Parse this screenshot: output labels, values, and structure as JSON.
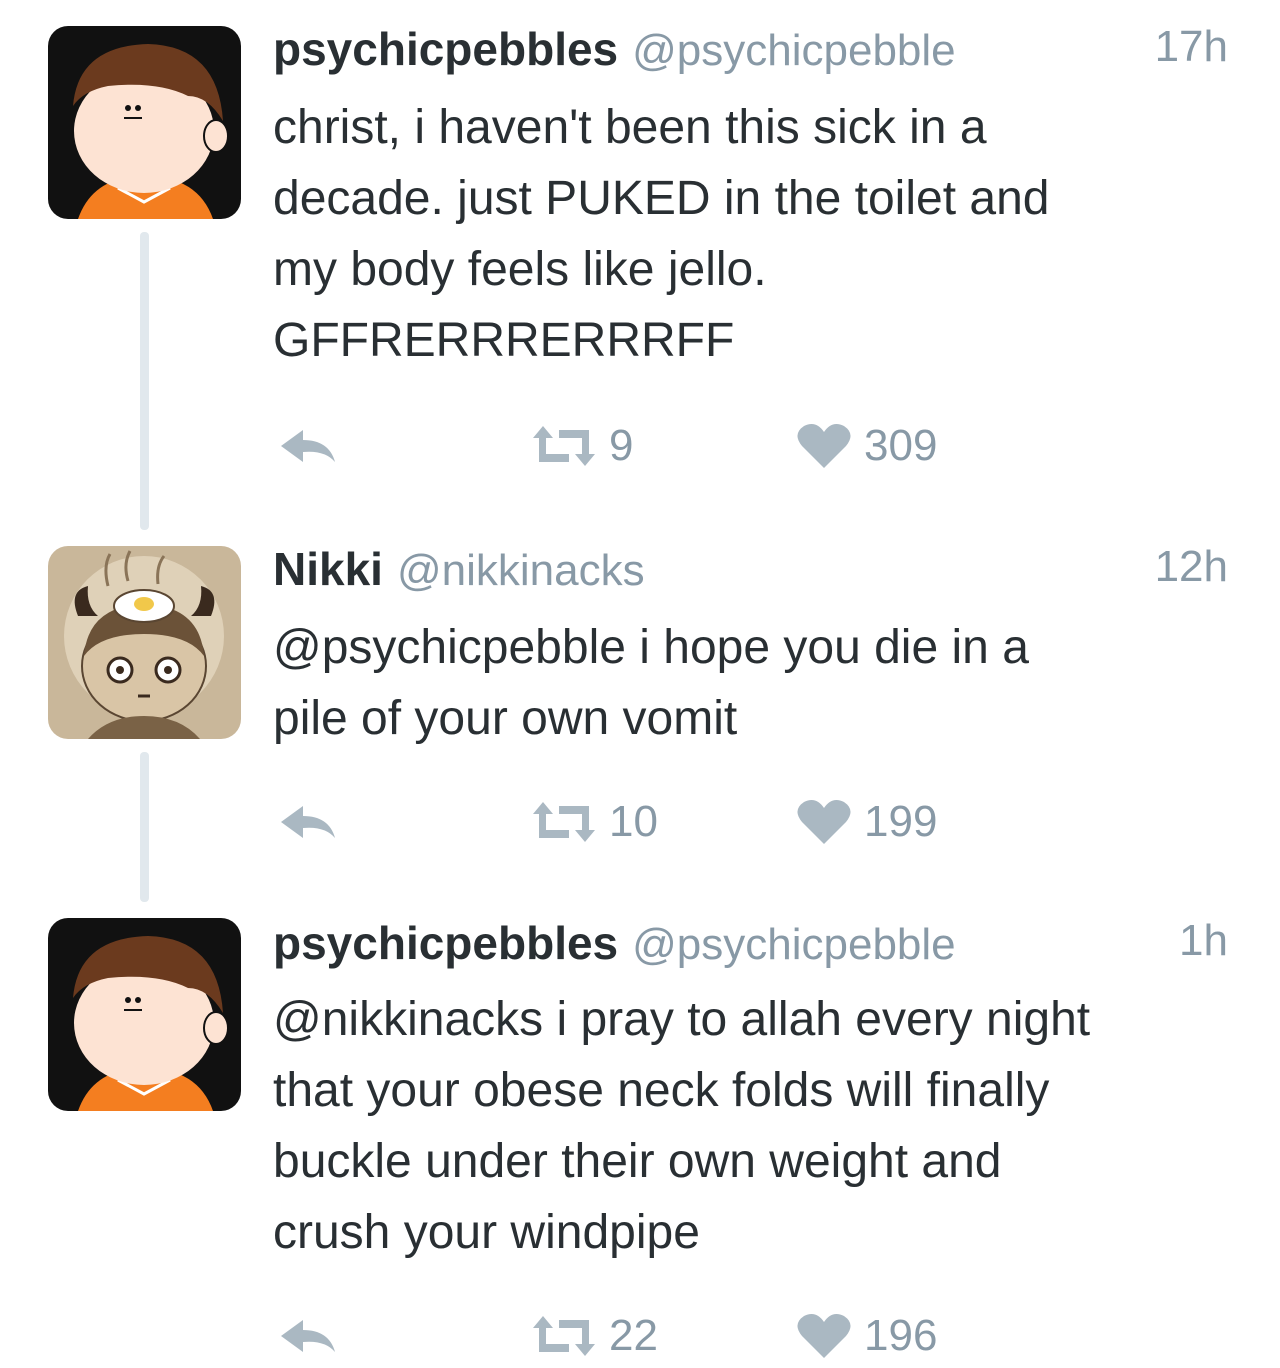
{
  "tweets": [
    {
      "name": "psychicpebbles",
      "handle": "@psychicpebble",
      "time": "17h",
      "lines": [
        "christ, i haven't been this sick in a",
        "decade. just PUKED in the toilet and",
        "my body feels like jello.",
        "GFFRERRRERRRFF"
      ],
      "retweets": "9",
      "likes": "309",
      "avatar": "orange-shirt-boy-avatar"
    },
    {
      "name": "Nikki",
      "handle": "@nikkinacks",
      "time": "12h",
      "lines": [
        "@psychicpebble i hope you die in a",
        "pile of your own vomit"
      ],
      "retweets": "10",
      "likes": "199",
      "avatar": "horned-girl-avatar"
    },
    {
      "name": "psychicpebbles",
      "handle": "@psychicpebble",
      "time": "1h",
      "lines": [
        "@nikkinacks i pray to allah every night",
        "that your obese neck folds will finally",
        "buckle under their own weight and",
        "crush your windpipe"
      ],
      "retweets": "22",
      "likes": "196",
      "avatar": "orange-shirt-boy-avatar"
    }
  ],
  "colors": {
    "text": "#292f33",
    "secondary": "#8899a6",
    "icon": "#aab8c2",
    "thread_line": "#e1e8ed",
    "shirt": "#f47e20"
  }
}
